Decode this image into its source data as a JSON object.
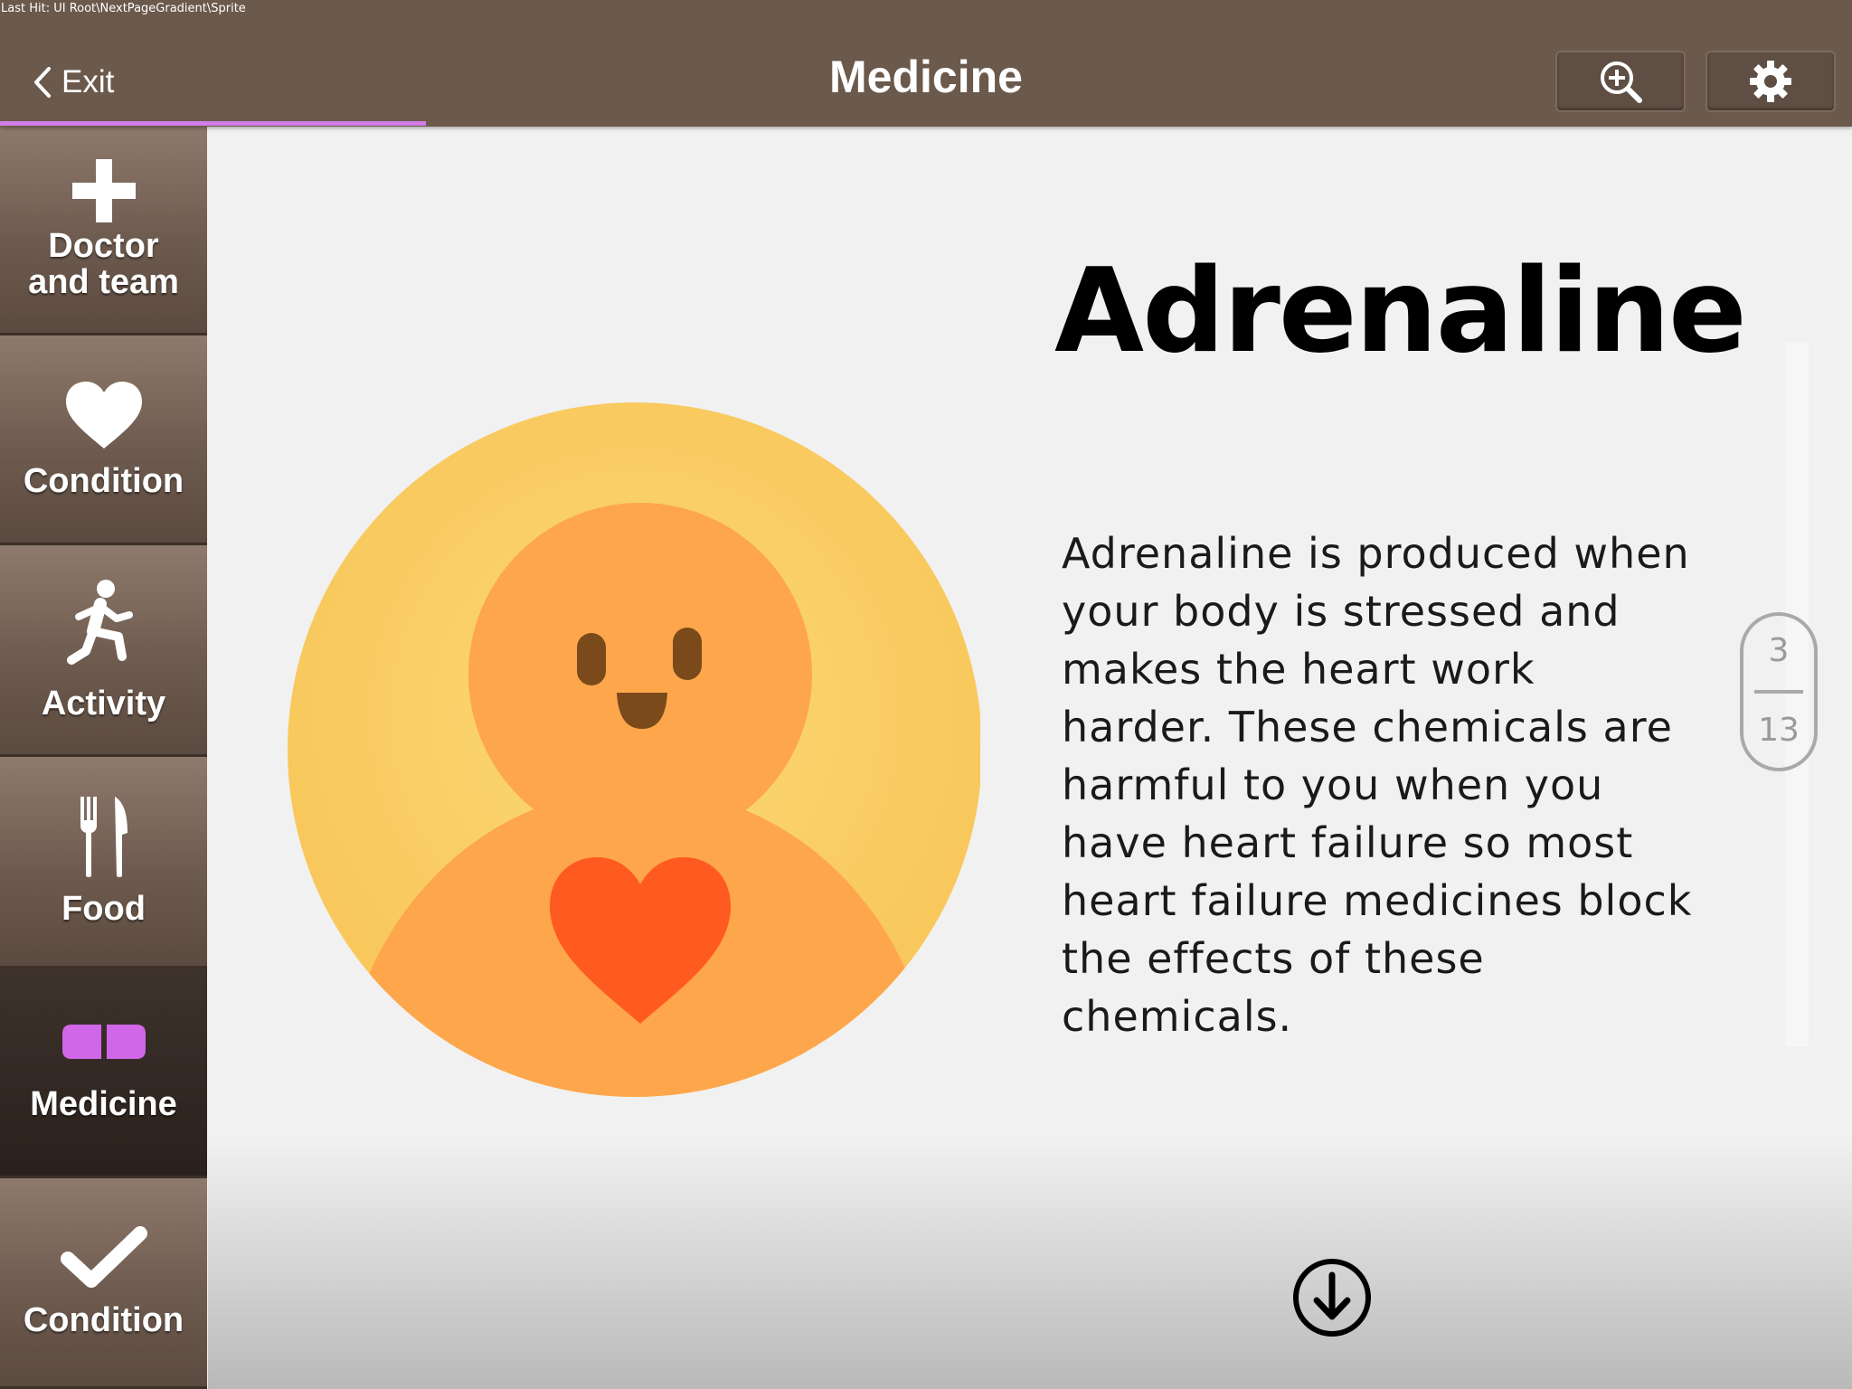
{
  "debug": {
    "text": "Last Hit: UI Root\\NextPageGradient\\Sprite"
  },
  "header": {
    "exit_label": "Exit",
    "title": "Medicine",
    "zoom_icon": "zoom-in-icon",
    "settings_icon": "gear-icon",
    "progress_fraction": 0.23
  },
  "sidebar": {
    "items": [
      {
        "label": "Doctor and team",
        "line1": "Doctor",
        "line2": "and team",
        "icon": "plus-icon",
        "active": false
      },
      {
        "label": "Condition",
        "icon": "heart-icon",
        "active": false
      },
      {
        "label": "Activity",
        "icon": "running-person-icon",
        "active": false
      },
      {
        "label": "Food",
        "icon": "fork-knife-icon",
        "active": false
      },
      {
        "label": "Medicine",
        "icon": "pill-icon",
        "active": true
      },
      {
        "label": "Condition",
        "icon": "checkmark-icon",
        "active": false
      }
    ]
  },
  "main": {
    "heading": "Adrenaline",
    "body": "Adrenaline is produced when your body is stressed and makes the heart work harder. These chemicals are harmful to you when you have heart failure so most heart failure medicines block the effects of these chemicals.",
    "illustration_icon": "smiling-person-heart-icon"
  },
  "pager": {
    "current": "3",
    "total": "13"
  },
  "next_icon": "arrow-down-circle-icon",
  "colors": {
    "topbar": "#6b594c",
    "accent": "#d27de8",
    "sidebar_active": "#2e241f",
    "circle_bg": "#f9c95c",
    "figure": "#fea64b",
    "heart": "#ff5a1f"
  }
}
